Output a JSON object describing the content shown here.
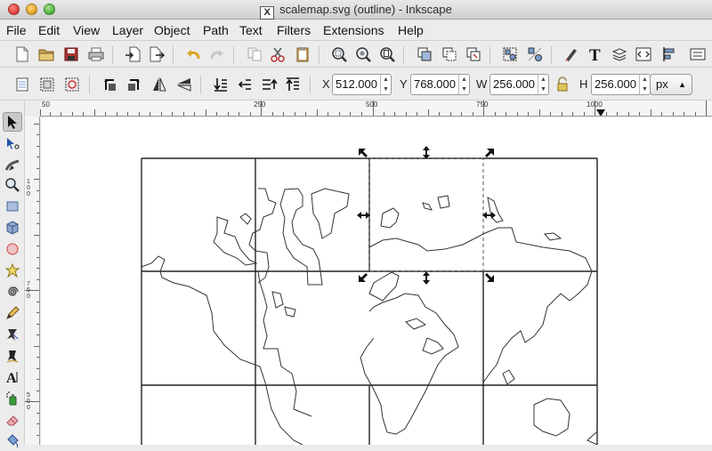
{
  "window": {
    "title": "scalemap.svg (outline) - Inkscape",
    "x11_glyph": "X"
  },
  "menu": [
    {
      "label": "File"
    },
    {
      "label": "Edit"
    },
    {
      "label": "View"
    },
    {
      "label": "Layer"
    },
    {
      "label": "Object"
    },
    {
      "label": "Path"
    },
    {
      "label": "Text"
    },
    {
      "label": "Filters"
    },
    {
      "label": "Extensions"
    },
    {
      "label": "Help"
    }
  ],
  "commands_bar": {
    "icons": [
      "new-document",
      "open",
      "save",
      "print",
      "import",
      "export",
      "undo",
      "redo",
      "copy",
      "cut",
      "paste",
      "zoom-selection",
      "zoom-drawing",
      "zoom-page",
      "duplicate",
      "clone",
      "unlink-clone",
      "group",
      "ungroup",
      "fill-stroke",
      "text-font",
      "layers",
      "xml-editor",
      "align"
    ]
  },
  "select_bar": {
    "x": {
      "label": "X",
      "value": "512.000"
    },
    "y": {
      "label": "Y",
      "value": "768.000"
    },
    "w": {
      "label": "W",
      "value": "256.000"
    },
    "h": {
      "label": "H",
      "value": "256.000"
    },
    "unit": "px",
    "lock_icon": "lock-icon"
  },
  "ruler": {
    "h_labels": [
      "50",
      "250",
      "500",
      "750",
      "1000"
    ],
    "v_labels": [
      "100",
      "750",
      "500"
    ]
  },
  "tools": [
    "selector",
    "node",
    "tweak",
    "zoom",
    "rectangle",
    "3d-box",
    "ellipse",
    "star",
    "spiral",
    "pencil",
    "pen",
    "calligraphy",
    "text",
    "spray",
    "eraser",
    "bucket"
  ]
}
